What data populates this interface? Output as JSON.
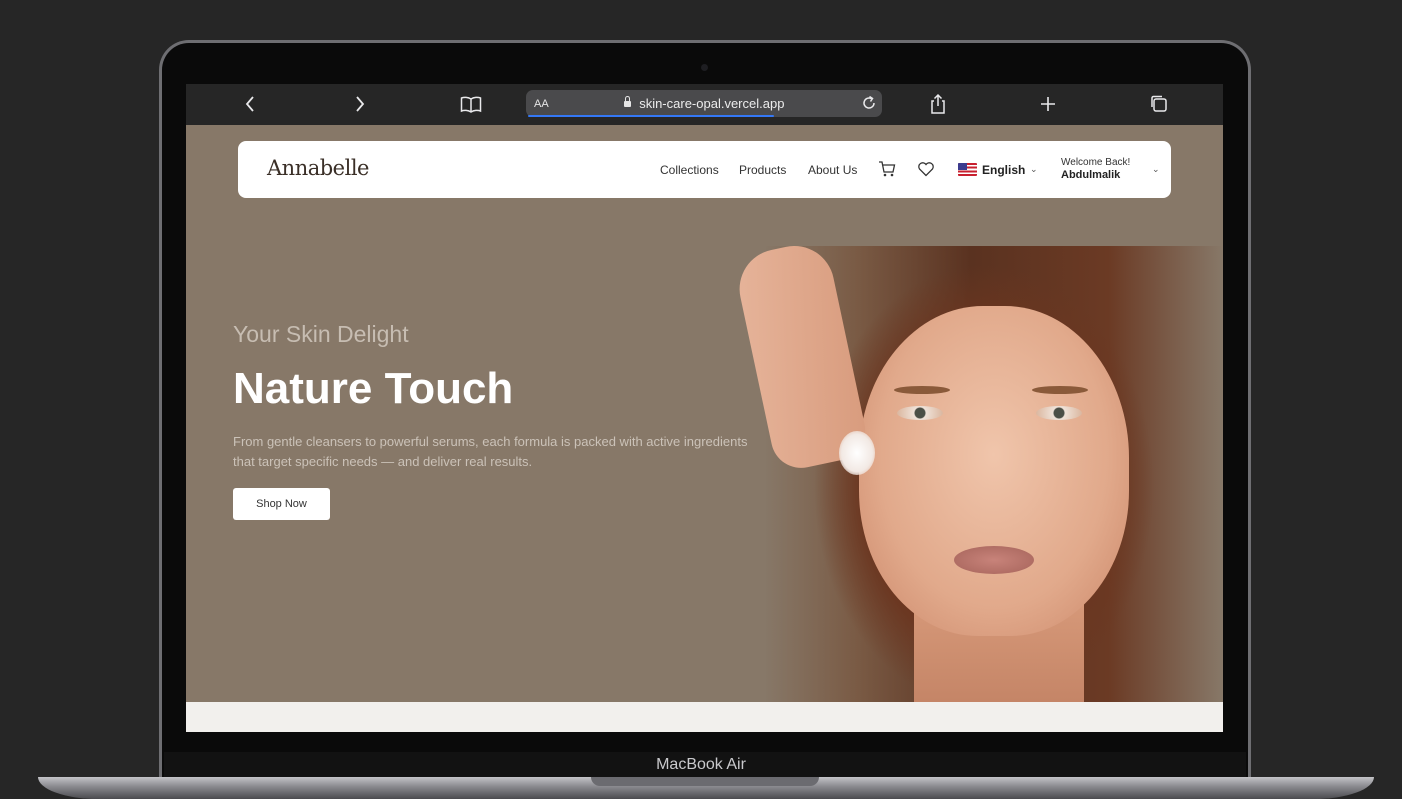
{
  "device": {
    "label": "MacBook Air"
  },
  "browser": {
    "text_size_label": "AA",
    "url": "skin-care-opal.vercel.app",
    "load_progress": 0.7,
    "icons": [
      "back-icon",
      "forward-icon",
      "bookmarks-icon",
      "lock-icon",
      "reload-icon",
      "share-icon",
      "new-tab-icon",
      "tabs-icon"
    ]
  },
  "header": {
    "logo": "Annabelle",
    "nav": {
      "collections": "Collections",
      "products": "Products",
      "about": "About Us"
    },
    "icons": [
      "cart-icon",
      "heart-icon",
      "us-flag-icon",
      "chevron-down-icon"
    ],
    "language": "English",
    "welcome": "Welcome Back!",
    "user": "Abdulmalik"
  },
  "hero": {
    "subtitle": "Your Skin Delight",
    "title": "Nature Touch",
    "description": "From gentle cleansers to powerful serums, each formula is packed with active ingredients that target specific needs — and deliver real results.",
    "cta": "Shop Now"
  },
  "colors": {
    "hero_bg": "#877868",
    "nav_bg": "#ffffff",
    "title": "#ffffff",
    "subtitle": "#c7bdb2",
    "toolbar_bg": "#262626",
    "progress": "#3478f6"
  }
}
